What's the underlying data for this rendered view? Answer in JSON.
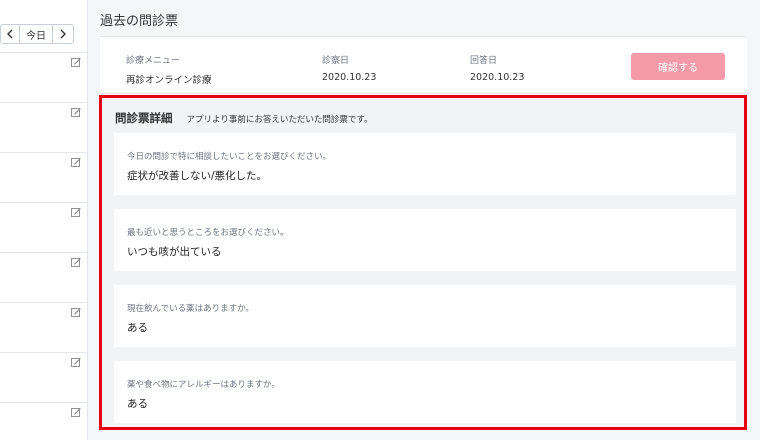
{
  "left_pane": {
    "nav": {
      "prev_icon": "chevron-left-icon",
      "today_label": "今日",
      "next_icon": "chevron-right-icon"
    },
    "rows": [
      {
        "icon": "edit-icon"
      },
      {
        "icon": "edit-icon"
      },
      {
        "icon": "edit-icon"
      },
      {
        "icon": "edit-icon"
      },
      {
        "icon": "edit-icon"
      },
      {
        "icon": "edit-icon"
      },
      {
        "icon": "edit-icon"
      },
      {
        "icon": "edit-icon"
      }
    ]
  },
  "main": {
    "page_title": "過去の問診票",
    "summary": {
      "menu_label": "診療メニュー",
      "menu_value": "再診オンライン診療",
      "consult_date_label": "診察日",
      "consult_date_value": "2020.10.23",
      "answer_date_label": "回答日",
      "answer_date_value": "2020.10.23",
      "confirm_button": "確認する"
    },
    "details": {
      "title": "問診票詳細",
      "description": "アプリより事前にお答えいただいた問診票です。",
      "questions": [
        {
          "question": "今日の問診で特に相談したいことをお選びください。",
          "answer": "症状が改善しない/悪化した。"
        },
        {
          "question": "最も近いと思うところをお選びください。",
          "answer": "いつも咳が出ている"
        },
        {
          "question": "現在飲んでいる薬はありますか。",
          "answer": "ある"
        },
        {
          "question": "薬や食べ物にアレルギーはありますか。",
          "answer": "ある"
        }
      ]
    }
  },
  "colors": {
    "highlight_border": "#e60012",
    "confirm_button_bg": "#f49aa8",
    "panel_bg": "#f1f3f6"
  }
}
